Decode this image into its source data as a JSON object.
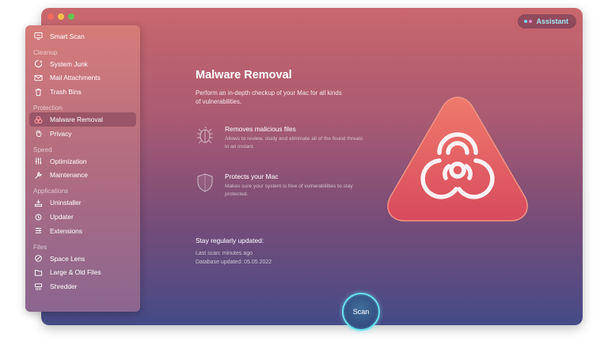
{
  "window": {
    "assistant_label": "Assistant"
  },
  "sidebar": {
    "top_item": {
      "label": "Smart Scan",
      "icon": "monitor-scan-icon"
    },
    "sections": [
      {
        "title": "Cleanup",
        "items": [
          {
            "label": "System Junk",
            "icon": "recycle-icon"
          },
          {
            "label": "Mail Attachments",
            "icon": "envelope-icon"
          },
          {
            "label": "Trash Bins",
            "icon": "trash-icon"
          }
        ]
      },
      {
        "title": "Protection",
        "items": [
          {
            "label": "Malware Removal",
            "icon": "biohazard-icon",
            "active": true
          },
          {
            "label": "Privacy",
            "icon": "hand-icon"
          }
        ]
      },
      {
        "title": "Speed",
        "items": [
          {
            "label": "Optimization",
            "icon": "sliders-icon"
          },
          {
            "label": "Maintenance",
            "icon": "wrench-icon"
          }
        ]
      },
      {
        "title": "Applications",
        "items": [
          {
            "label": "Uninstaller",
            "icon": "uninstaller-icon"
          },
          {
            "label": "Updater",
            "icon": "updater-icon"
          },
          {
            "label": "Extensions",
            "icon": "extensions-icon"
          }
        ]
      },
      {
        "title": "Files",
        "items": [
          {
            "label": "Space Lens",
            "icon": "lens-icon"
          },
          {
            "label": "Large & Old Files",
            "icon": "folder-icon"
          },
          {
            "label": "Shredder",
            "icon": "shredder-icon"
          }
        ]
      }
    ]
  },
  "main": {
    "title": "Malware Removal",
    "description": "Perform an in-depth checkup of your Mac for all kinds of vulnerabilities.",
    "features": [
      {
        "title": "Removes malicious files",
        "description": "Allows to review, study and eliminate all of the found threats in an instant.",
        "icon": "bug-icon"
      },
      {
        "title": "Protects your Mac",
        "description": "Makes sure your system is free of vulnerabilities to stay protected.",
        "icon": "shield-icon"
      }
    ],
    "update": {
      "title": "Stay regularly updated:",
      "last_scan": "Last scan: minutes ago",
      "database_updated": "Database updated: 05.05.2022"
    },
    "scan_label": "Scan"
  },
  "colors": {
    "accent_cyan": "#66e1ee",
    "hazard_red": "#e2575e",
    "gradient_top": "#c9676c",
    "gradient_bottom": "#454a86"
  }
}
